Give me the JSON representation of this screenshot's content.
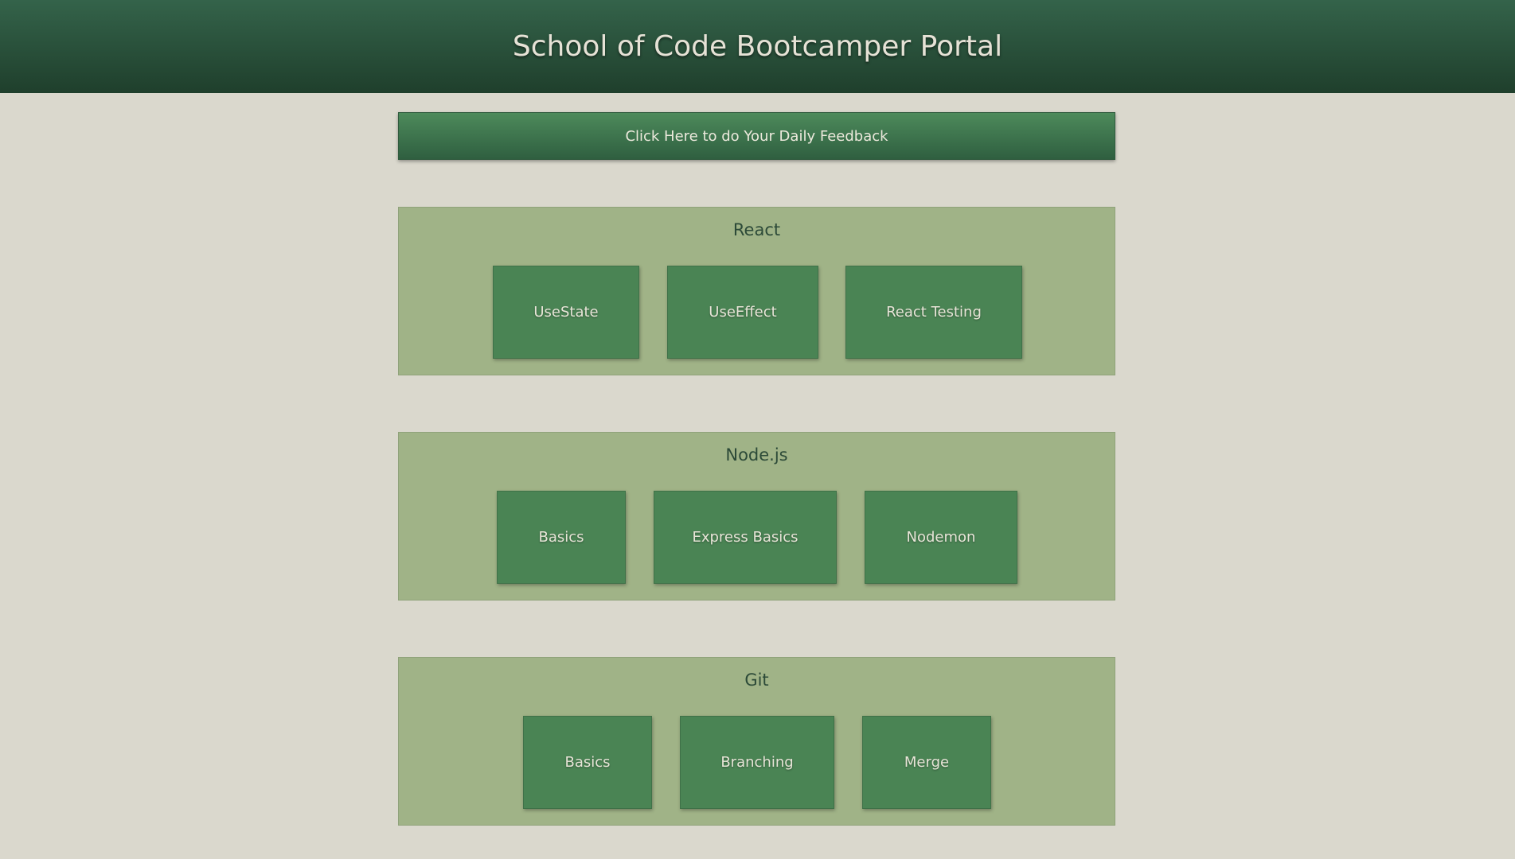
{
  "header": {
    "title": "School of Code Bootcamper Portal"
  },
  "feedback_button": {
    "label": "Click Here to do Your Daily Feedback"
  },
  "sections": [
    {
      "title": "React",
      "cards": [
        "UseState",
        "UseEffect",
        "React Testing"
      ]
    },
    {
      "title": "Node.js",
      "cards": [
        "Basics",
        "Express Basics",
        "Nodemon"
      ]
    },
    {
      "title": "Git",
      "cards": [
        "Basics",
        "Branching",
        "Merge"
      ]
    }
  ],
  "colors": {
    "background": "#dad8cd",
    "header": "#2a5039",
    "section": "#a0b387",
    "card": "#4a8454"
  }
}
